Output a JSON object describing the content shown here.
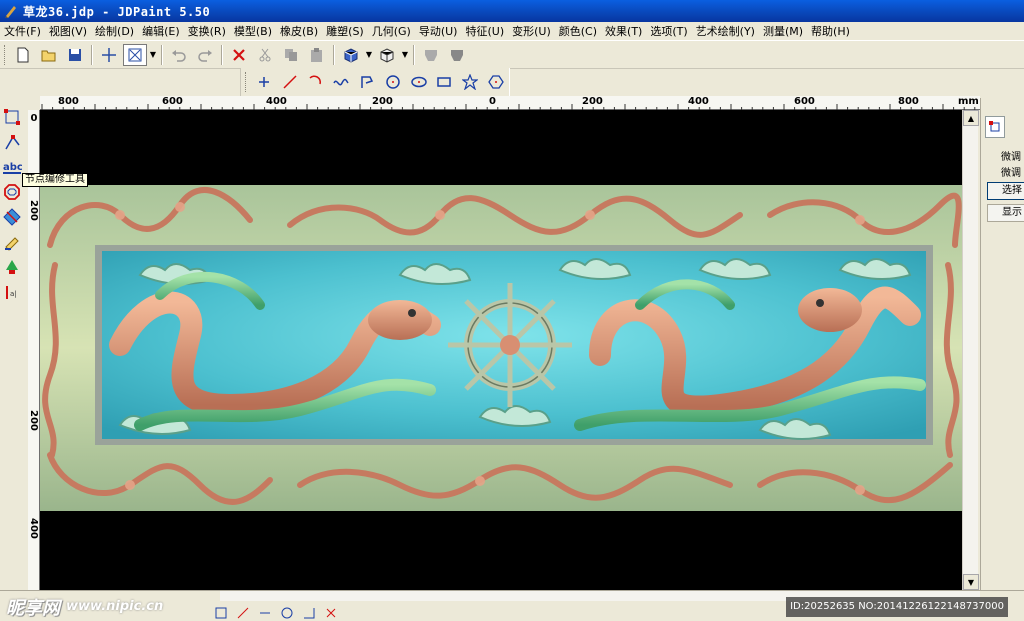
{
  "window": {
    "title": "草龙36.jdp - JDPaint 5.50"
  },
  "menu": [
    "文件(F)",
    "视图(V)",
    "绘制(D)",
    "编辑(E)",
    "变换(R)",
    "模型(B)",
    "橡皮(B)",
    "雕塑(S)",
    "几何(G)",
    "导动(U)",
    "特征(U)",
    "变形(U)",
    "颜色(C)",
    "效果(T)",
    "选项(T)",
    "艺术绘制(Y)",
    "测量(M)",
    "帮助(H)"
  ],
  "ruler_h": {
    "labels": [
      "800",
      "600",
      "400",
      "200",
      "0",
      "200",
      "400",
      "600",
      "800"
    ],
    "unit": "mm"
  },
  "ruler_v": {
    "labels": [
      "0",
      "200",
      "200",
      "400"
    ]
  },
  "tooltip": "节点编修工具",
  "right_panel": {
    "line1": "微调",
    "line2": "微调",
    "button1": "选择",
    "button2": "显示"
  },
  "watermark": {
    "brand": "昵享网",
    "url": "www.nipic.cn",
    "id_text": "ID:20252635 NO:20141226122148737000"
  },
  "colors": {
    "titlebar": "#0a5fe0",
    "frame": "#d0866a",
    "panel": "#4bb8c8",
    "dragon_body": "#d88f72",
    "dragon_fin": "#6cbf8a",
    "background": "#000000"
  }
}
